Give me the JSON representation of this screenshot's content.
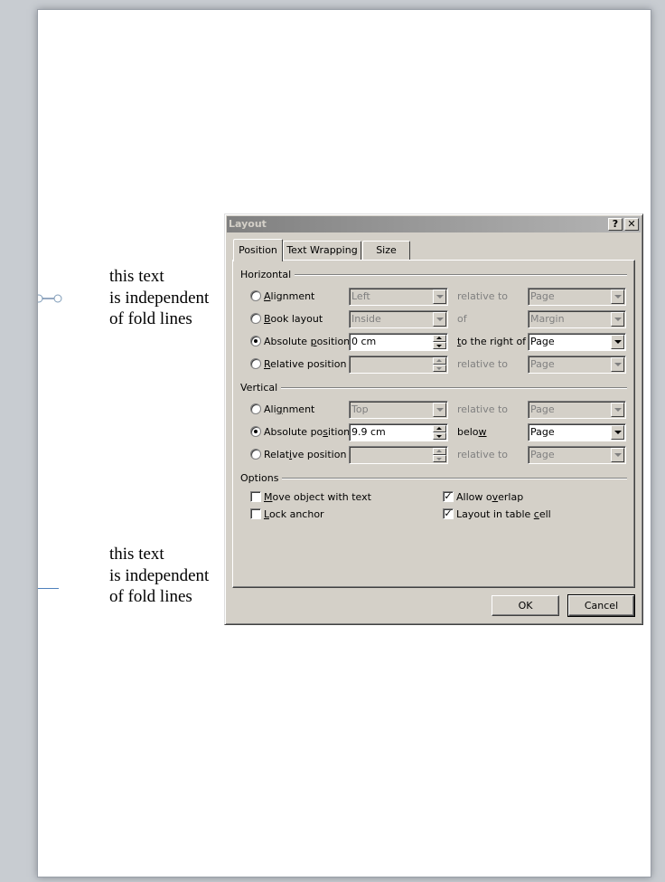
{
  "document": {
    "text_block_1": "this text\nis independent\nof fold lines",
    "text_block_2": "this text\nis independent\nof fold lines"
  },
  "dialog": {
    "title": "Layout",
    "help_icon": "?",
    "close_icon": "✕",
    "tabs": [
      {
        "label": "Position",
        "active": true
      },
      {
        "label": "Text Wrapping",
        "active": false
      },
      {
        "label": "Size",
        "active": false
      }
    ],
    "horizontal": {
      "group_label": "Horizontal",
      "rows": [
        {
          "label_ul": "A",
          "label_rest": "lignment",
          "checked": false,
          "value": "Left",
          "relation": "relative to",
          "relation_value": "Page",
          "enabled": false
        },
        {
          "label_ul": "B",
          "label_rest": "ook layout",
          "checked": false,
          "value": "Inside",
          "relation": "of",
          "relation_value": "Margin",
          "enabled": false
        },
        {
          "label_pre": "Absolute ",
          "label_ul": "p",
          "label_rest": "osition",
          "checked": true,
          "value": "0 cm",
          "relation_ul": "t",
          "relation_rest": "o the right of",
          "relation_value": "Page",
          "enabled": true
        },
        {
          "label_ul": "R",
          "label_rest": "elative position",
          "checked": false,
          "value": "",
          "relation": "relative to",
          "relation_value": "Page",
          "enabled": false
        }
      ]
    },
    "vertical": {
      "group_label": "Vertical",
      "rows": [
        {
          "label_pre": "Ali",
          "label_ul": "g",
          "label_rest": "nment",
          "checked": false,
          "value": "Top",
          "relation": "relative to",
          "relation_value": "Page",
          "enabled": false
        },
        {
          "label_pre": "Absolute po",
          "label_ul": "s",
          "label_rest": "ition",
          "checked": true,
          "value": "9.9 cm",
          "relation_pre": "belo",
          "relation_ul": "w",
          "relation_value": "Page",
          "enabled": true
        },
        {
          "label_pre": "Relat",
          "label_ul": "i",
          "label_rest": "ve position",
          "checked": false,
          "value": "",
          "relation": "relative to",
          "relation_value": "Page",
          "enabled": false
        }
      ]
    },
    "options": {
      "group_label": "Options",
      "move_object": {
        "ul": "M",
        "rest": "ove object with text",
        "checked": false
      },
      "lock_anchor": {
        "ul": "L",
        "rest": "ock anchor",
        "checked": false
      },
      "allow_overlap": {
        "pre": "Allow o",
        "ul": "v",
        "rest": "erlap",
        "checked": true
      },
      "layout_in_cell": {
        "pre": "Layout in table ",
        "ul": "c",
        "rest": "ell",
        "checked": true
      },
      "check_mark": "✓"
    },
    "ok_label": "OK",
    "cancel_label": "Cancel"
  }
}
